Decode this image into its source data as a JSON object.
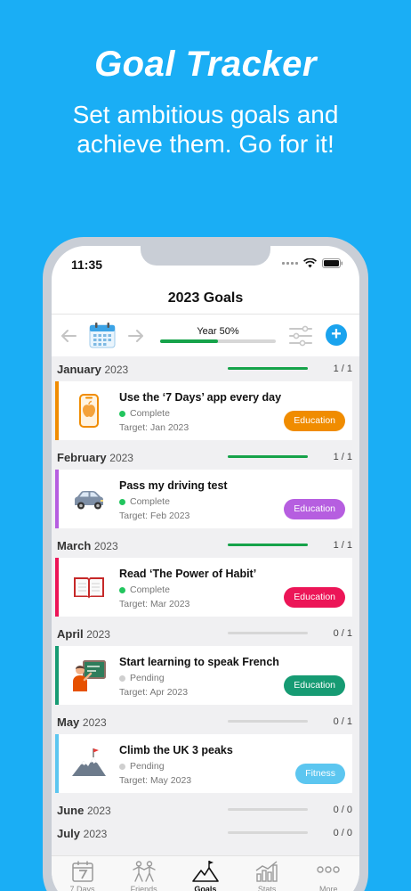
{
  "promo": {
    "title": "Goal Tracker",
    "subtitle_line1": "Set ambitious goals and",
    "subtitle_line2": "achieve them. Go for it!"
  },
  "status_bar": {
    "time": "11:35"
  },
  "nav": {
    "title": "2023 Goals"
  },
  "toolbar": {
    "year_label": "Year 50%",
    "year_progress": 0.5,
    "add_label": "+",
    "icons": [
      "arrow-left-icon",
      "calendar-icon",
      "arrow-right-icon",
      "filter-sliders-icon",
      "plus-circle-icon"
    ]
  },
  "months": [
    {
      "name": "January",
      "year": "2023",
      "count": "1 / 1",
      "progress": 1
    },
    {
      "name": "February",
      "year": "2023",
      "count": "1 / 1",
      "progress": 1
    },
    {
      "name": "March",
      "year": "2023",
      "count": "1 / 1",
      "progress": 1
    },
    {
      "name": "April",
      "year": "2023",
      "count": "0 / 1",
      "progress": 0
    },
    {
      "name": "May",
      "year": "2023",
      "count": "0 / 1",
      "progress": 0
    },
    {
      "name": "June",
      "year": "2023",
      "count": "0 / 0",
      "progress": 0
    },
    {
      "name": "July",
      "year": "2023",
      "count": "0 / 0",
      "progress": 0
    }
  ],
  "goals": [
    {
      "title": "Use the ‘7 Days’ app every day",
      "status": "Complete",
      "target": "Target:  Jan 2023",
      "tag": "Education",
      "color": "#f08c00",
      "icon": "phone-icon"
    },
    {
      "title": "Pass my driving test",
      "status": "Complete",
      "target": "Target:  Feb 2023",
      "tag": "Education",
      "color": "#b65ee0",
      "icon": "car-icon"
    },
    {
      "title": "Read ‘The Power of Habit’",
      "status": "Complete",
      "target": "Target:  Mar 2023",
      "tag": "Education",
      "color": "#ec1557",
      "icon": "book-icon"
    },
    {
      "title": "Start learning to speak French",
      "status": "Pending",
      "target": "Target:  Apr 2023",
      "tag": "Education",
      "color": "#169b73",
      "icon": "teacher-icon"
    },
    {
      "title": "Climb the UK 3 peaks",
      "status": "Pending",
      "target": "Target:  May 2023",
      "tag": "Fitness",
      "color": "#5cc6f0",
      "icon": "mountain-icon"
    }
  ],
  "status_colors": {
    "Complete": "#22c55e",
    "Pending": "#cfcfcf"
  },
  "tabs": [
    {
      "label": "7 Days",
      "icon": "calendar-7-icon"
    },
    {
      "label": "Friends",
      "icon": "friends-icon"
    },
    {
      "label": "Goals",
      "icon": "goals-mountain-icon"
    },
    {
      "label": "Stats",
      "icon": "stats-icon"
    },
    {
      "label": "More",
      "icon": "more-icon"
    }
  ],
  "active_tab": "Goals"
}
